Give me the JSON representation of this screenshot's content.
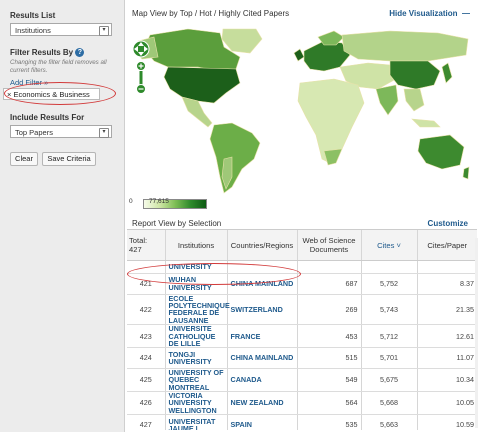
{
  "sidebar": {
    "results_list_label": "Results List",
    "results_list_value": "Institutions",
    "filter_label": "Filter Results By",
    "filter_hint": "Changing the filter field removes all current filters.",
    "add_filter_label": "Add Filter »",
    "active_filter": "× Economics & Business",
    "include_label": "Include Results For",
    "include_value": "Top Papers",
    "clear_label": "Clear",
    "save_label": "Save Criteria"
  },
  "map": {
    "title": "Map View by Top / Hot / Highly Cited Papers",
    "hide_label": "Hide Visualization",
    "legend_min": "0",
    "legend_max": "77,615"
  },
  "report": {
    "title": "Report View by Selection",
    "customize_label": "Customize",
    "headers": {
      "total": "Total:",
      "total_count": "427",
      "institutions": "Institutions",
      "countries": "Countries/Regions",
      "wos": "Web of Science Documents",
      "cites": "Cites ˅",
      "cites_paper": "Cites/Paper"
    },
    "stub_row": {
      "institution": "UNIVERSITY"
    },
    "rows": [
      {
        "rank": "421",
        "institution": "WUHAN UNIVERSITY",
        "country": "CHINA MAINLAND",
        "documents": "687",
        "cites": "5,752",
        "cites_per_paper": "8.37"
      },
      {
        "rank": "422",
        "institution": "ECOLE POLYTECHNIQUE FEDERALE DE LAUSANNE",
        "country": "SWITZERLAND",
        "documents": "269",
        "cites": "5,743",
        "cites_per_paper": "21.35"
      },
      {
        "rank": "423",
        "institution": "UNIVERSITE CATHOLIQUE DE LILLE",
        "country": "FRANCE",
        "documents": "453",
        "cites": "5,712",
        "cites_per_paper": "12.61"
      },
      {
        "rank": "424",
        "institution": "TONGJI UNIVERSITY",
        "country": "CHINA MAINLAND",
        "documents": "515",
        "cites": "5,701",
        "cites_per_paper": "11.07"
      },
      {
        "rank": "425",
        "institution": "UNIVERSITY OF QUEBEC MONTREAL",
        "country": "CANADA",
        "documents": "549",
        "cites": "5,675",
        "cites_per_paper": "10.34"
      },
      {
        "rank": "426",
        "institution": "VICTORIA UNIVERSITY WELLINGTON",
        "country": "NEW ZEALAND",
        "documents": "564",
        "cites": "5,668",
        "cites_per_paper": "10.05"
      },
      {
        "rank": "427",
        "institution": "UNIVERSITAT JAUME I",
        "country": "SPAIN",
        "documents": "535",
        "cites": "5,663",
        "cites_per_paper": "10.59"
      }
    ]
  },
  "colors": {
    "link": "#1f5a8c",
    "highlight": "#d23a3a",
    "map_dark": "#0d5a13",
    "map_light": "#f6fbe9"
  }
}
